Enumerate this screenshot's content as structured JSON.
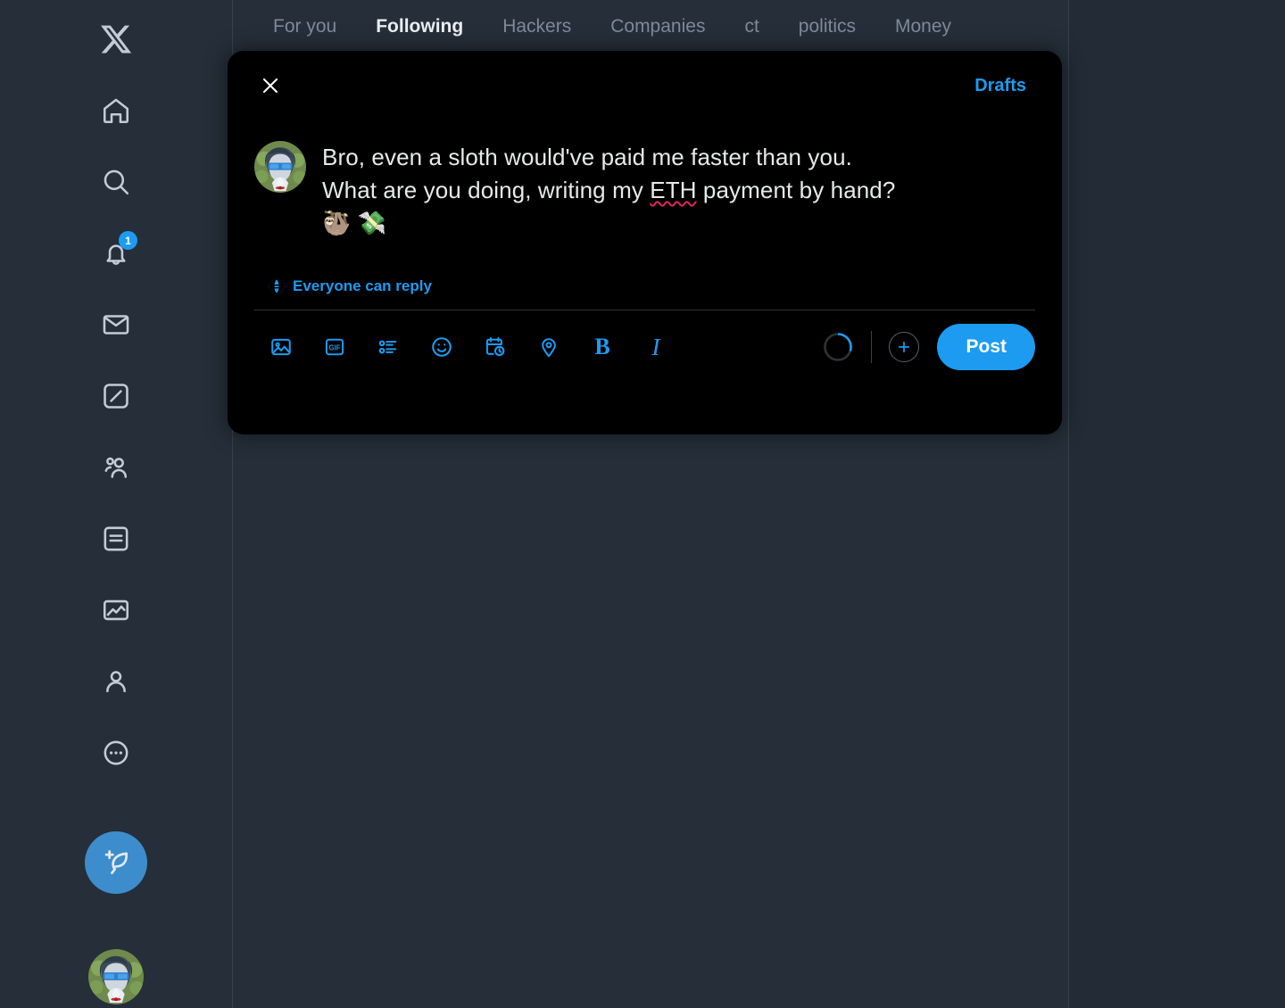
{
  "colors": {
    "accent": "#1d9bf0",
    "app_bg": "#222b36",
    "panel_bg": "#252e39",
    "modal_bg": "#000000",
    "text_primary": "#e7e9ea",
    "text_muted": "#7d8a98",
    "spellcheck": "#e0245e",
    "compose_fab": "#3d8dcc"
  },
  "sidebar": {
    "logo": "x-logo",
    "items": [
      {
        "name": "home",
        "icon": "home-icon",
        "badge": null
      },
      {
        "name": "search",
        "icon": "search-icon",
        "badge": null
      },
      {
        "name": "notifications",
        "icon": "bell-icon",
        "badge": "1"
      },
      {
        "name": "messages",
        "icon": "envelope-icon",
        "badge": null
      },
      {
        "name": "grok",
        "icon": "grok-icon",
        "badge": null
      },
      {
        "name": "communities",
        "icon": "communities-icon",
        "badge": null
      },
      {
        "name": "lists",
        "icon": "lists-icon",
        "badge": null
      },
      {
        "name": "premium",
        "icon": "chart-image-icon",
        "badge": null
      },
      {
        "name": "profile",
        "icon": "person-icon",
        "badge": null
      },
      {
        "name": "more",
        "icon": "more-dots-icon",
        "badge": null
      }
    ],
    "compose": {
      "icon": "feather-plus-icon"
    },
    "account_avatar": "user-avatar"
  },
  "timeline": {
    "tabs": [
      {
        "label": "For you",
        "active": false
      },
      {
        "label": "Following",
        "active": true
      },
      {
        "label": "Hackers",
        "active": false
      },
      {
        "label": "Companies",
        "active": false
      },
      {
        "label": "ct",
        "active": false
      },
      {
        "label": "politics",
        "active": false
      },
      {
        "label": "Money",
        "active": false
      }
    ]
  },
  "compose_modal": {
    "close_icon": "close-icon",
    "drafts_label": "Drafts",
    "avatar": "user-avatar",
    "text_line_1": "Bro, even a sloth would've paid me faster than you.",
    "text_line_2_pre": "What are you doing, writing my ",
    "text_line_2_spellcheck": "ETH",
    "text_line_2_post": " payment by hand?",
    "text_line_3_emoji": "🦥 💸",
    "reply_scope": {
      "icon": "globe-icon",
      "label": "Everyone can reply"
    },
    "toolbar": {
      "tools": [
        {
          "name": "media",
          "icon": "image-icon",
          "label": ""
        },
        {
          "name": "gif",
          "icon": "gif-icon",
          "label": "GIF"
        },
        {
          "name": "poll",
          "icon": "poll-icon",
          "label": ""
        },
        {
          "name": "emoji",
          "icon": "emoji-icon",
          "label": ""
        },
        {
          "name": "schedule",
          "icon": "calendar-clock-icon",
          "label": ""
        },
        {
          "name": "location",
          "icon": "location-pin-icon",
          "label": ""
        },
        {
          "name": "bold",
          "icon": "bold-icon",
          "label": "B"
        },
        {
          "name": "italic",
          "icon": "italic-icon",
          "label": "I"
        }
      ],
      "char_progress_percent": 30,
      "add_post_icon": "plus-icon",
      "post_label": "Post"
    }
  }
}
